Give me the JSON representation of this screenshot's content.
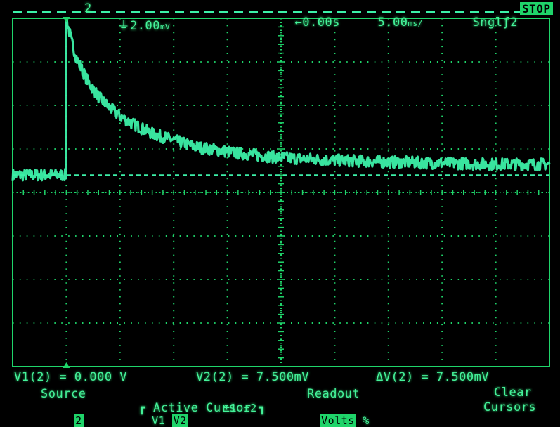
{
  "header": {
    "channel": "2",
    "volts_per_div": "2.00",
    "volts_unit": "mV",
    "delay": "0.00s",
    "time_per_div": "5.00",
    "time_unit": "ms/",
    "trigger_mode": "Sngl",
    "trigger_source": "2",
    "run_state": "STOP"
  },
  "readout": {
    "v1": "V1(2) = 0.000 V",
    "v2": "V2(2) = 7.500mV",
    "dv": "ΔV(2) = 7.500mV"
  },
  "softkeys": [
    {
      "label": "Source",
      "sub": "2"
    },
    {
      "label": "Active Cursor",
      "sub": "V1 V2",
      "sub_highlight": "V2"
    },
    {
      "label": "",
      "sub": "±1 ±2"
    },
    {
      "label": "Readout",
      "sub": "Volts %",
      "sub_highlight": "Volts"
    },
    {
      "label": "Clear",
      "sub": "Cursors"
    }
  ],
  "colors": {
    "trace": "#3cf0a8",
    "grid": "#1fd46a",
    "text": "#45f29a",
    "background": "#000000"
  },
  "cursors": {
    "v1_level_mv": 0.0,
    "v2_level_mv": 7.5
  },
  "chart_data": {
    "type": "line",
    "volts_per_div_mv": 2.0,
    "time_per_div_ms": 5.0,
    "divisions_x": 10,
    "divisions_y": 8,
    "ylim_mv": [
      -8.8,
      7.2
    ],
    "xlim_ms": [
      -25.0,
      25.0
    ],
    "series": [
      {
        "x_ms": [
          -25.0,
          -20.0,
          -20.0,
          -19.5,
          -19.0,
          -18.0,
          -17.0,
          -16.0,
          -15.0,
          -14.0,
          -12.0,
          -10.0,
          -8.0,
          -6.0,
          -4.0,
          -2.0,
          0.0,
          5.0,
          10.0,
          15.0,
          20.0,
          25.0
        ],
        "y_mv": [
          0.0,
          0.0,
          7.2,
          6.1,
          5.3,
          4.3,
          3.6,
          3.1,
          2.7,
          2.4,
          1.9,
          1.6,
          1.3,
          1.15,
          1.0,
          0.9,
          0.8,
          0.68,
          0.6,
          0.55,
          0.5,
          0.5
        ]
      }
    ]
  }
}
